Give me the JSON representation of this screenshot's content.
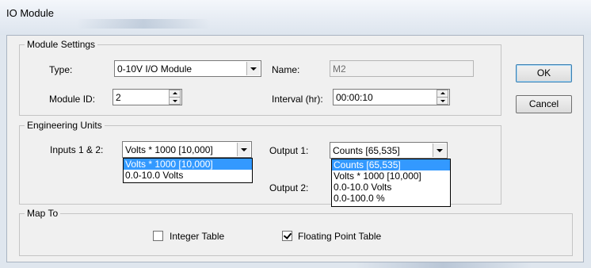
{
  "window": {
    "title": "IO Module"
  },
  "module_settings": {
    "legend": "Module Settings",
    "type_label": "Type:",
    "type_value": "0-10V I/O Module",
    "name_label": "Name:",
    "name_value": "M2",
    "module_id_label": "Module ID:",
    "module_id_value": "2",
    "interval_label": "Interval (hr):",
    "interval_value": "00:00:10"
  },
  "engineering_units": {
    "legend": "Engineering Units",
    "inputs_label": "Inputs 1 & 2:",
    "inputs_value": "Volts * 1000 [10,000]",
    "inputs_options": [
      "Volts * 1000 [10,000]",
      "0.0-10.0 Volts"
    ],
    "output1_label": "Output 1:",
    "output1_value": "Counts [65,535]",
    "output1_options": [
      "Counts [65,535]",
      "Volts * 1000 [10,000]",
      "0.0-10.0 Volts",
      "0.0-100.0 %"
    ],
    "output2_label": "Output 2:"
  },
  "map_to": {
    "legend": "Map To",
    "integer_table_label": "Integer Table",
    "integer_table_checked": false,
    "floating_point_label": "Floating Point Table",
    "floating_point_checked": true
  },
  "buttons": {
    "ok": "OK",
    "cancel": "Cancel"
  }
}
